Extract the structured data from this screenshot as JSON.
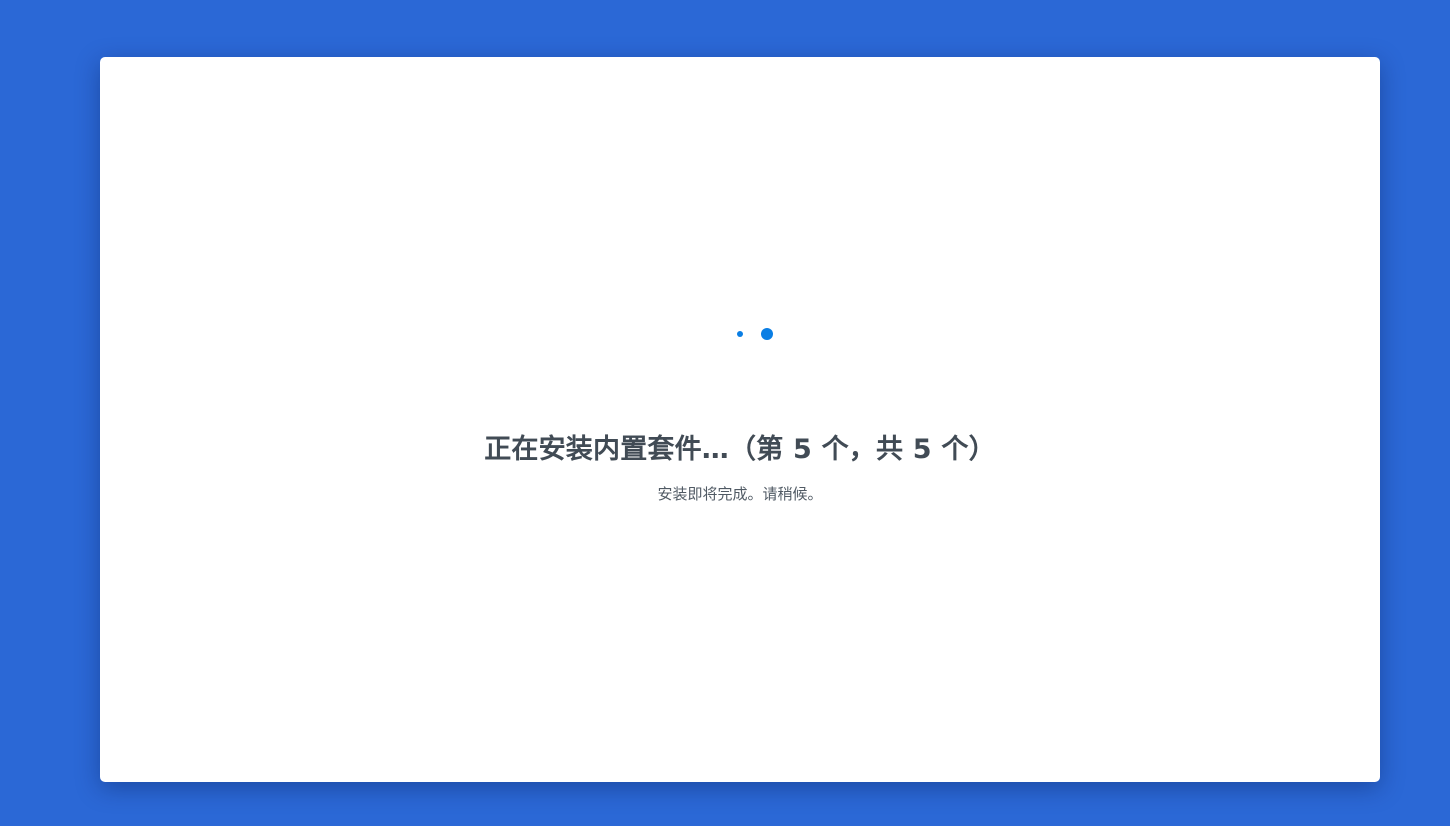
{
  "install": {
    "title": "正在安装内置套件…（第 5 个，共 5 个）",
    "subtitle": "安装即将完成。请稍候。",
    "current_package": 5,
    "total_packages": 5
  },
  "colors": {
    "background": "#2b68d6",
    "card": "#ffffff",
    "spinner": "#0a7ee4",
    "title_text": "#414b55",
    "subtitle_text": "#505a64"
  },
  "icons": {
    "spinner": "loading-dots-icon"
  }
}
